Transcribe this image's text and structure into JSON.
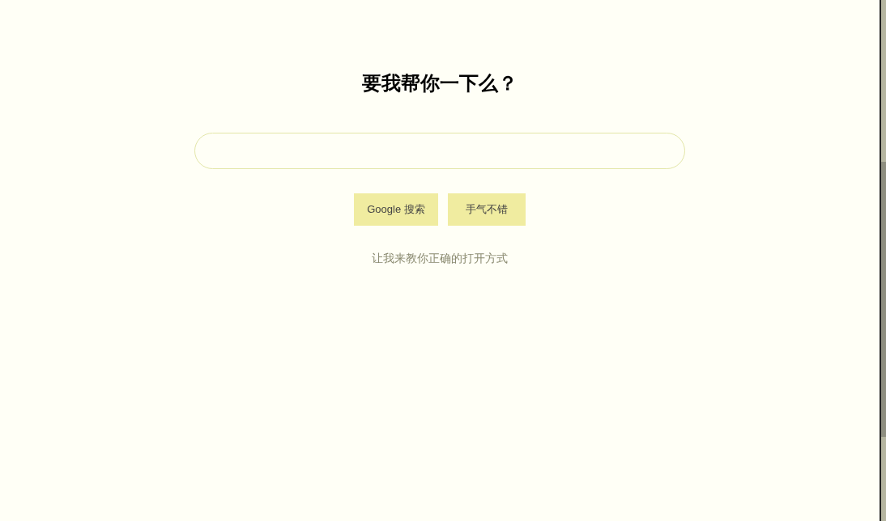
{
  "heading": "要我帮你一下么？",
  "buttons": [
    "Google 搜索",
    "手气不错"
  ],
  "link": "让我来教你正确的打开方式"
}
